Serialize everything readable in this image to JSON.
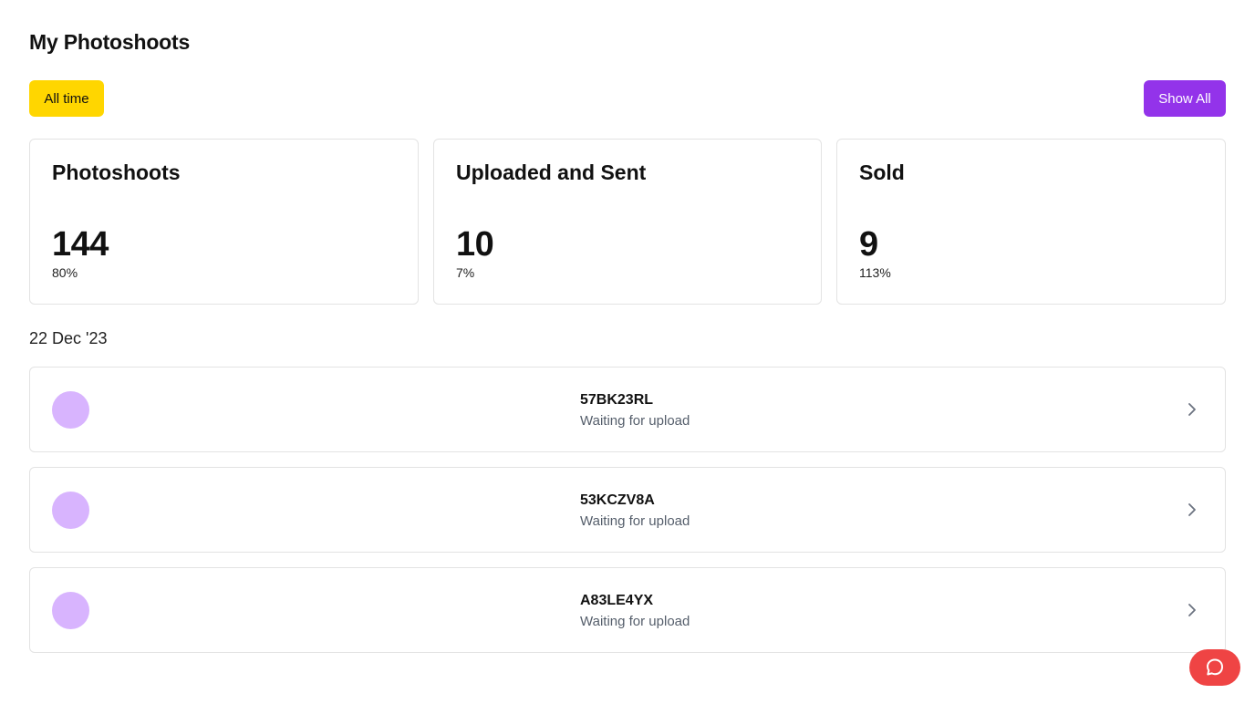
{
  "header": {
    "title": "My Photoshoots"
  },
  "toolbar": {
    "filter_label": "All time",
    "show_all_label": "Show All"
  },
  "stats": [
    {
      "title": "Photoshoots",
      "value": "144",
      "percent": "80%"
    },
    {
      "title": "Uploaded and Sent",
      "value": "10",
      "percent": "7%"
    },
    {
      "title": "Sold",
      "value": "9",
      "percent": "113%"
    }
  ],
  "group": {
    "date": "22 Dec '23"
  },
  "photoshoots": [
    {
      "code": "57BK23RL",
      "status": "Waiting for upload"
    },
    {
      "code": "53KCZV8A",
      "status": "Waiting for upload"
    },
    {
      "code": "A83LE4YX",
      "status": "Waiting for upload"
    }
  ],
  "icons": {
    "row_action": "chevron-right-icon",
    "chat": "chat-bubble-icon"
  },
  "colors": {
    "filter_accent": "#ffd600",
    "primary": "#9333ea",
    "avatar": "#d8b4fe",
    "chat_fab": "#ef4444"
  }
}
